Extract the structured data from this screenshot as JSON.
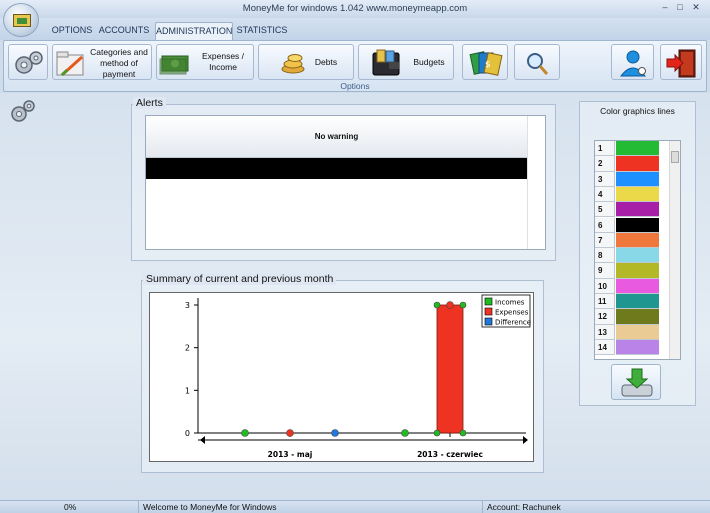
{
  "window": {
    "title": "MoneyMe for windows 1.042 www.moneymeapp.com",
    "minimize": "–",
    "maximize": "□",
    "close": "✕"
  },
  "tabs": [
    {
      "label": "OPTIONS"
    },
    {
      "label": "ACCOUNTS"
    },
    {
      "label": "ADMINISTRATION"
    },
    {
      "label": "STATISTICS"
    }
  ],
  "ribbon": {
    "group_label": "Options",
    "categories_label": "Categories and method of payment",
    "expenses_label": "Expenses / Income",
    "debts_label": "Debts",
    "budgets_label": "Budgets"
  },
  "alerts": {
    "title": "Alerts",
    "message": "No warning"
  },
  "summary": {
    "title": "Summary of current and previous month"
  },
  "chart_data": {
    "type": "bar",
    "title": "",
    "xlabel": "",
    "ylabel": "",
    "categories": [
      "2013 - maj",
      "2013 - czerwiec"
    ],
    "series": [
      {
        "name": "Incomes",
        "values": [
          0,
          0
        ],
        "color": "#22bb22"
      },
      {
        "name": "Expenses",
        "values": [
          0,
          3
        ],
        "color": "#ee3322"
      },
      {
        "name": "Difference",
        "values": [
          0,
          0
        ],
        "color": "#2277dd"
      }
    ],
    "ylim": [
      0,
      3
    ],
    "yticks": [
      "0",
      "1",
      "2",
      "3"
    ],
    "legend": "top-right",
    "grid": false
  },
  "colors_panel": {
    "title": "Color graphics lines",
    "rows": [
      {
        "n": "1",
        "color": "#22bb33"
      },
      {
        "n": "2",
        "color": "#ee3322"
      },
      {
        "n": "3",
        "color": "#1e90ff"
      },
      {
        "n": "4",
        "color": "#ecd94a"
      },
      {
        "n": "5",
        "color": "#a61fa6"
      },
      {
        "n": "6",
        "color": "#000000"
      },
      {
        "n": "7",
        "color": "#f0783c"
      },
      {
        "n": "8",
        "color": "#88d8e8"
      },
      {
        "n": "9",
        "color": "#b2b826"
      },
      {
        "n": "10",
        "color": "#e85ae0"
      },
      {
        "n": "11",
        "color": "#1f9690"
      },
      {
        "n": "12",
        "color": "#6f7a1c"
      },
      {
        "n": "13",
        "color": "#ebcb94"
      },
      {
        "n": "14",
        "color": "#b983e8"
      }
    ]
  },
  "status": {
    "progress": "0%",
    "message": "Welcome to MoneyMe for Windows",
    "account": "Account: Rachunek"
  }
}
